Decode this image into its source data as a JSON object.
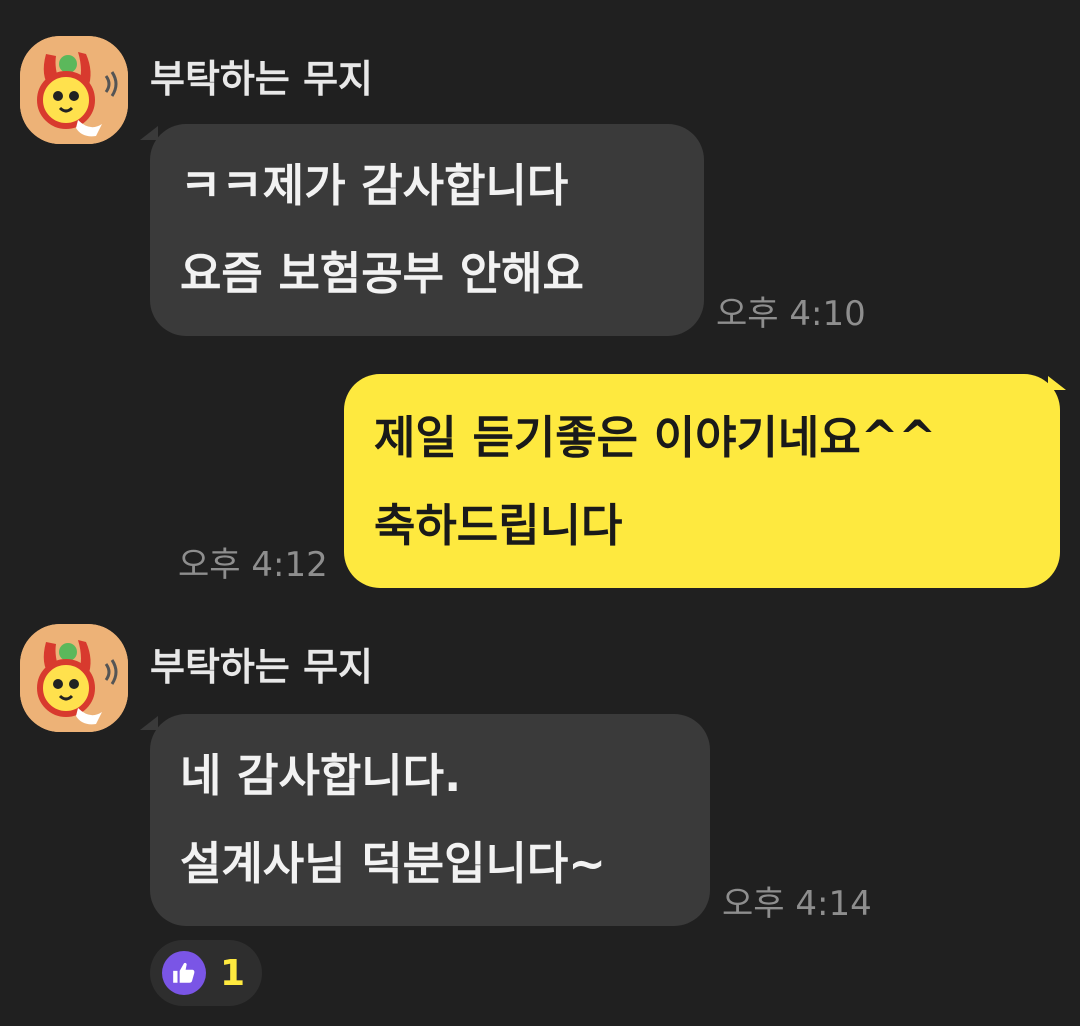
{
  "messages": [
    {
      "direction": "incoming",
      "sender": "부탁하는 무지",
      "lines": [
        "ㅋㅋ제가 감사합니다",
        "요즘 보험공부 안해요"
      ],
      "time": "오후 4:10"
    },
    {
      "direction": "outgoing",
      "lines": [
        "제일 듣기좋은 이야기네요^^",
        "축하드립니다"
      ],
      "time": "오후 4:12"
    },
    {
      "direction": "incoming",
      "sender": "부탁하는 무지",
      "lines": [
        "네 감사합니다.",
        "설계사님 덕분입니다~"
      ],
      "time": "오후 4:14",
      "reaction": {
        "icon": "thumbs-up-icon",
        "count": "1"
      }
    }
  ],
  "colors": {
    "background": "#202020",
    "incoming_bubble": "#3A3A3A",
    "outgoing_bubble": "#FEE93F",
    "reaction_accent": "#7A55E6",
    "reaction_count": "#FEE93F"
  }
}
